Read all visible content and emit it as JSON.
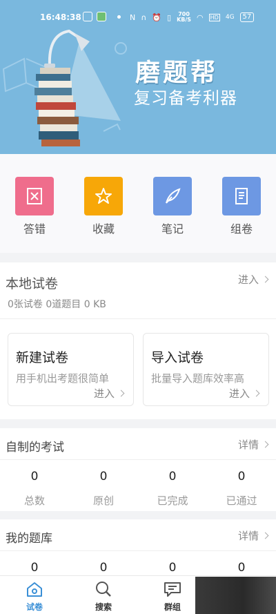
{
  "status_bar": {
    "time": "16:48:38",
    "net_speed_value": "700",
    "net_speed_unit": "KB/S",
    "network": "4G",
    "battery": "57"
  },
  "header": {
    "brand_title": "磨题帮",
    "brand_subtitle": "复习备考利器"
  },
  "quick_actions": [
    {
      "label": "答错",
      "color": "#ef6d8c",
      "icon": "wrong-answer-icon"
    },
    {
      "label": "收藏",
      "color": "#f7a708",
      "icon": "star-icon"
    },
    {
      "label": "笔记",
      "color": "#6d98e3",
      "icon": "feather-pen-icon"
    },
    {
      "label": "组卷",
      "color": "#6d98e3",
      "icon": "paper-scroll-icon"
    }
  ],
  "local": {
    "title": "本地试卷",
    "link": "进入",
    "summary": "0张试卷 0道题目 0 KB",
    "new_title": "新建试卷",
    "new_desc": "用手机出考题很简单",
    "new_enter": "进入",
    "import_title": "导入试卷",
    "import_desc": "批量导入题库效率高",
    "import_enter": "进入"
  },
  "exams": {
    "title": "自制的考试",
    "link": "详情",
    "stats": [
      {
        "value": "0",
        "label": "总数"
      },
      {
        "value": "0",
        "label": "原创"
      },
      {
        "value": "0",
        "label": "已完成"
      },
      {
        "value": "0",
        "label": "已通过"
      }
    ]
  },
  "bank": {
    "title": "我的题库",
    "link": "详情",
    "values": [
      "0",
      "0",
      "0",
      "0"
    ]
  },
  "nav": [
    {
      "label": "试卷",
      "icon": "home-icon",
      "active": true
    },
    {
      "label": "搜索",
      "icon": "search-icon",
      "active": false
    },
    {
      "label": "群组",
      "icon": "chat-group-icon",
      "active": false
    }
  ]
}
